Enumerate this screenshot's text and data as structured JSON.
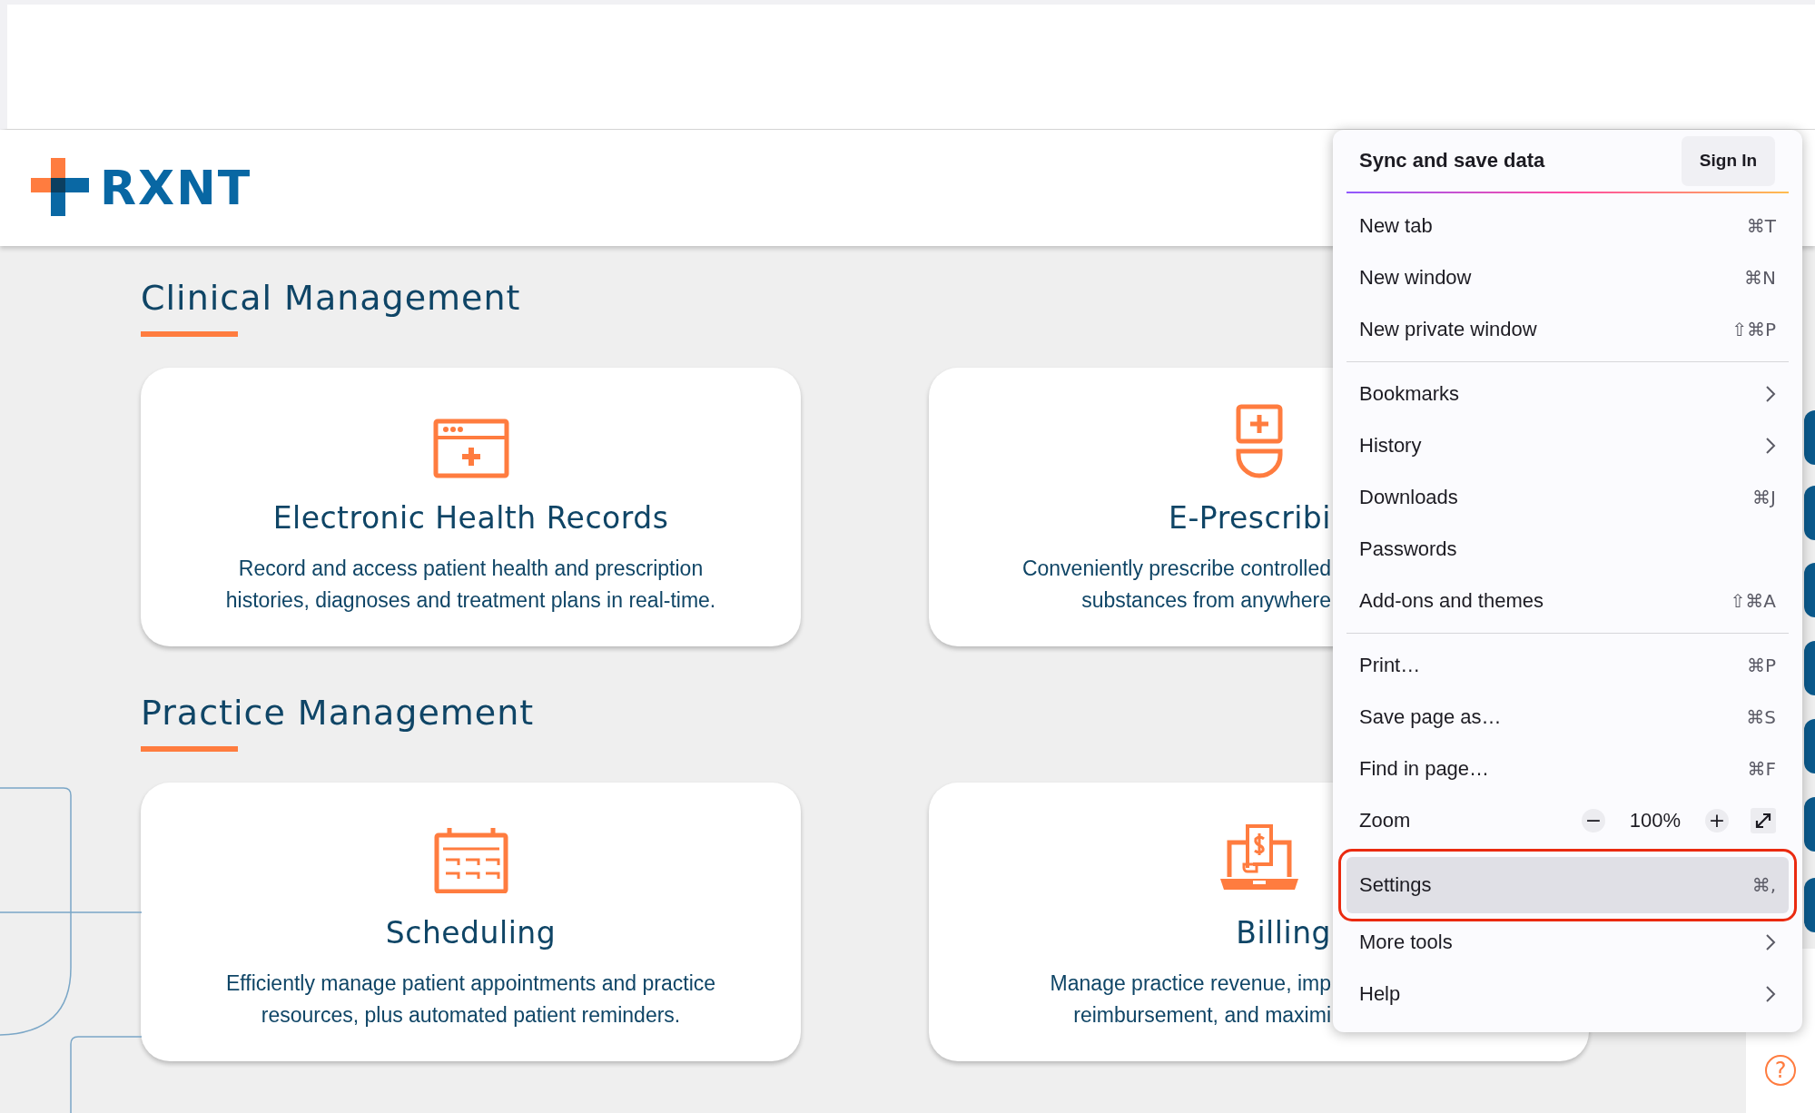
{
  "header": {
    "logo": "RXNT"
  },
  "sections": [
    {
      "title": "Clinical Management",
      "cards": [
        {
          "title": "Electronic Health Records",
          "lines": [
            "Record and access patient health and prescription",
            "histories, diagnoses and treatment plans in real-time."
          ]
        },
        {
          "title": "E-Prescribi",
          "lines": [
            "Conveniently prescribe controlled",
            "substances from anywhere"
          ]
        }
      ]
    },
    {
      "title": "Practice Management",
      "cards": [
        {
          "title": "Scheduling",
          "lines": [
            "Efficiently manage patient appointments and practice",
            "resources, plus automated patient reminders."
          ]
        },
        {
          "title": "Billing",
          "lines": [
            "Manage practice revenue, imp",
            "reimbursement, and maximi"
          ]
        }
      ]
    }
  ],
  "menu": {
    "sync": {
      "title": "Sync and save data",
      "button": "Sign In"
    },
    "groups": [
      [
        {
          "kind": "shortcut",
          "label": "New tab",
          "shortcut": "⌘T",
          "selected": false
        },
        {
          "kind": "shortcut",
          "label": "New window",
          "shortcut": "⌘N",
          "selected": false
        },
        {
          "kind": "shortcut",
          "label": "New private window",
          "shortcut": "⇧⌘P",
          "selected": false
        }
      ],
      [
        {
          "kind": "submenu",
          "label": "Bookmarks",
          "selected": false
        },
        {
          "kind": "submenu",
          "label": "History",
          "selected": false
        },
        {
          "kind": "shortcut",
          "label": "Downloads",
          "shortcut": "⌘J",
          "selected": false
        },
        {
          "kind": "shortcut",
          "label": "Passwords",
          "selected": false
        },
        {
          "kind": "shortcut",
          "label": "Add-ons and themes",
          "shortcut": "⇧⌘A",
          "selected": false
        }
      ],
      [
        {
          "kind": "shortcut",
          "label": "Print…",
          "shortcut": "⌘P",
          "selected": false
        },
        {
          "kind": "shortcut",
          "label": "Save page as…",
          "shortcut": "⌘S",
          "selected": false
        },
        {
          "kind": "shortcut",
          "label": "Find in page…",
          "shortcut": "⌘F",
          "selected": false
        },
        {
          "kind": "zoom",
          "label": "Zoom",
          "minus": "−",
          "value": "100%",
          "plus": "+"
        },
        {
          "kind": "shortcut",
          "label": "Settings",
          "shortcut": "⌘,",
          "selected": true
        },
        {
          "kind": "submenu",
          "label": "More tools",
          "selected": false
        },
        {
          "kind": "submenu",
          "label": "Help",
          "selected": false
        }
      ]
    ]
  },
  "help_button": "?"
}
